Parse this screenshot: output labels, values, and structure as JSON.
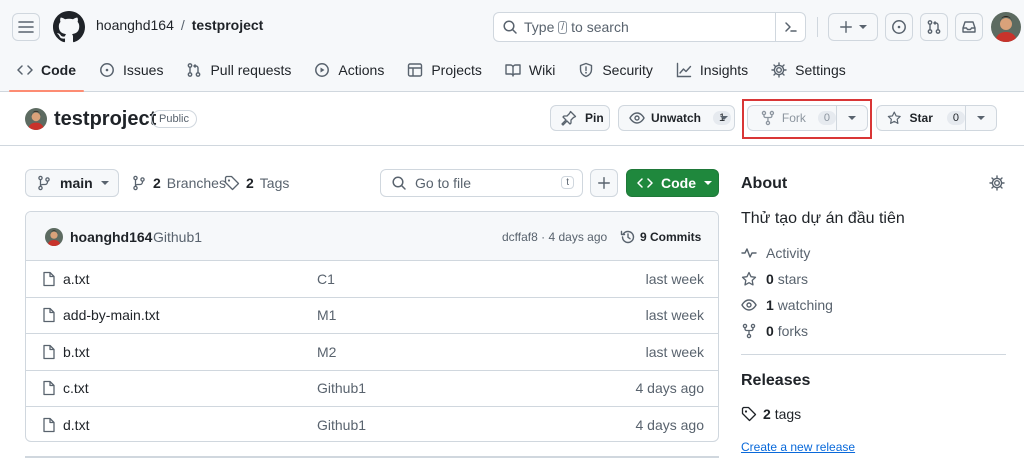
{
  "header": {
    "owner": "hoanghd164",
    "separator": "/",
    "repo": "testproject",
    "search_placeholder": "Type",
    "search_key": "/",
    "search_suffix": "to search"
  },
  "nav": {
    "code": "Code",
    "issues": "Issues",
    "pulls": "Pull requests",
    "actions": "Actions",
    "projects": "Projects",
    "wiki": "Wiki",
    "security": "Security",
    "insights": "Insights",
    "settings": "Settings"
  },
  "repo_header": {
    "title": "testproject",
    "visibility": "Public",
    "pin": "Pin",
    "unwatch": "Unwatch",
    "watch_count": "1",
    "fork": "Fork",
    "fork_count": "0",
    "star": "Star",
    "star_count": "0"
  },
  "toolbar": {
    "branch": "main",
    "branches_count": "2",
    "branches_label": "Branches",
    "tags_count": "2",
    "tags_label": "Tags",
    "goto_placeholder": "Go to file",
    "goto_key": "t",
    "code_button": "Code"
  },
  "latest_commit": {
    "author": "hoanghd164",
    "message": "Github1",
    "meta": "dcffaf8 · 4 days ago",
    "commits_count": "9 Commits"
  },
  "files": [
    {
      "name": "a.txt",
      "commit": "C1",
      "date": "last week"
    },
    {
      "name": "add-by-main.txt",
      "commit": "M1",
      "date": "last week"
    },
    {
      "name": "b.txt",
      "commit": "M2",
      "date": "last week"
    },
    {
      "name": "c.txt",
      "commit": "Github1",
      "date": "4 days ago"
    },
    {
      "name": "d.txt",
      "commit": "Github1",
      "date": "4 days ago"
    }
  ],
  "about": {
    "heading": "About",
    "description": "Thử tạo dự án đầu tiên",
    "activity": "Activity",
    "stars_count": "0",
    "stars_label": "stars",
    "watching_count": "1",
    "watching_label": "watching",
    "forks_count": "0",
    "forks_label": "forks"
  },
  "releases": {
    "heading": "Releases",
    "tags_count": "2",
    "tags_label": "tags",
    "create_link": "Create a new release"
  },
  "colors": {
    "accent_green": "#1f883d",
    "highlight_red": "#d93636",
    "link_blue": "#0969da",
    "nav_underline": "#fd8c73"
  }
}
